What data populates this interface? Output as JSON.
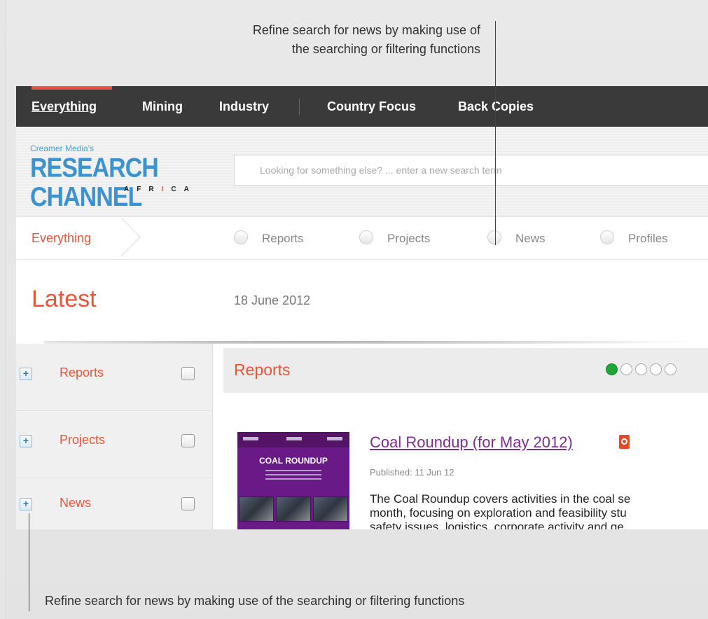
{
  "annotations": {
    "top_line1": "Refine search for news by making use of",
    "top_line2": "the searching or filtering functions",
    "bottom": "Refine search for news by making use of the searching or filtering functions"
  },
  "topnav": {
    "items": [
      "Everything",
      "Mining",
      "Industry",
      "Country Focus",
      "Back Copies"
    ],
    "active": "Everything"
  },
  "logo": {
    "pre": "Creamer Media's",
    "main": "RESEARCH CHANNEL",
    "sub": "AFRICA"
  },
  "search": {
    "placeholder": "Looking for something else? ... enter a new search term"
  },
  "filterbar": {
    "crumb": "Everything",
    "options": [
      "Reports",
      "Projects",
      "News",
      "Profiles"
    ]
  },
  "latest": {
    "title": "Latest",
    "date": "18 June 2012"
  },
  "sidebar": {
    "items": [
      {
        "label": "Reports"
      },
      {
        "label": "Projects"
      },
      {
        "label": "News"
      }
    ]
  },
  "content": {
    "title": "Reports",
    "pager": {
      "pages": 5,
      "current": 1
    },
    "article": {
      "thumb_title": "COAL ROUNDUP",
      "title": "Coal Roundup (for May 2012)",
      "published": "Published: 11 Jun 12",
      "summary_lines": [
        "The Coal Roundup covers activities in the coal se",
        "month, focusing on exploration and feasibility stu",
        "safety issues, logistics, corporate activity and ge"
      ]
    }
  },
  "colors": {
    "accent": "#e8553b",
    "nav_bg": "#3a3a3a",
    "link": "#7a2e8f",
    "pager_on": "#1fa53a"
  }
}
